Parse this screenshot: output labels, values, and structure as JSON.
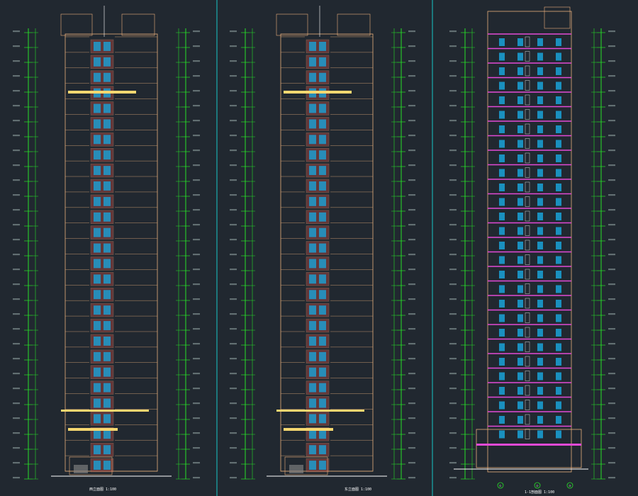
{
  "drawing": {
    "background": "#212830",
    "colors": {
      "dimension": "#27e027",
      "outline": "#e9b07c",
      "balcony": "#b34b45",
      "window": "#19a2d8",
      "accent_band": "#f5d770",
      "section_slab": "#e24ad6",
      "divider": "#18c9c9",
      "text": "#ffffff"
    },
    "floors": 28,
    "panels": [
      {
        "id": "elevation-west",
        "caption": "西立面图 1:100",
        "kind": "elevation"
      },
      {
        "id": "elevation-east",
        "caption": "东立面图 1:100",
        "kind": "elevation"
      },
      {
        "id": "section-1-1",
        "caption": "1-1剖面图 1:100",
        "kind": "section"
      }
    ],
    "grid_axes": [
      "①",
      "②",
      "③"
    ]
  }
}
